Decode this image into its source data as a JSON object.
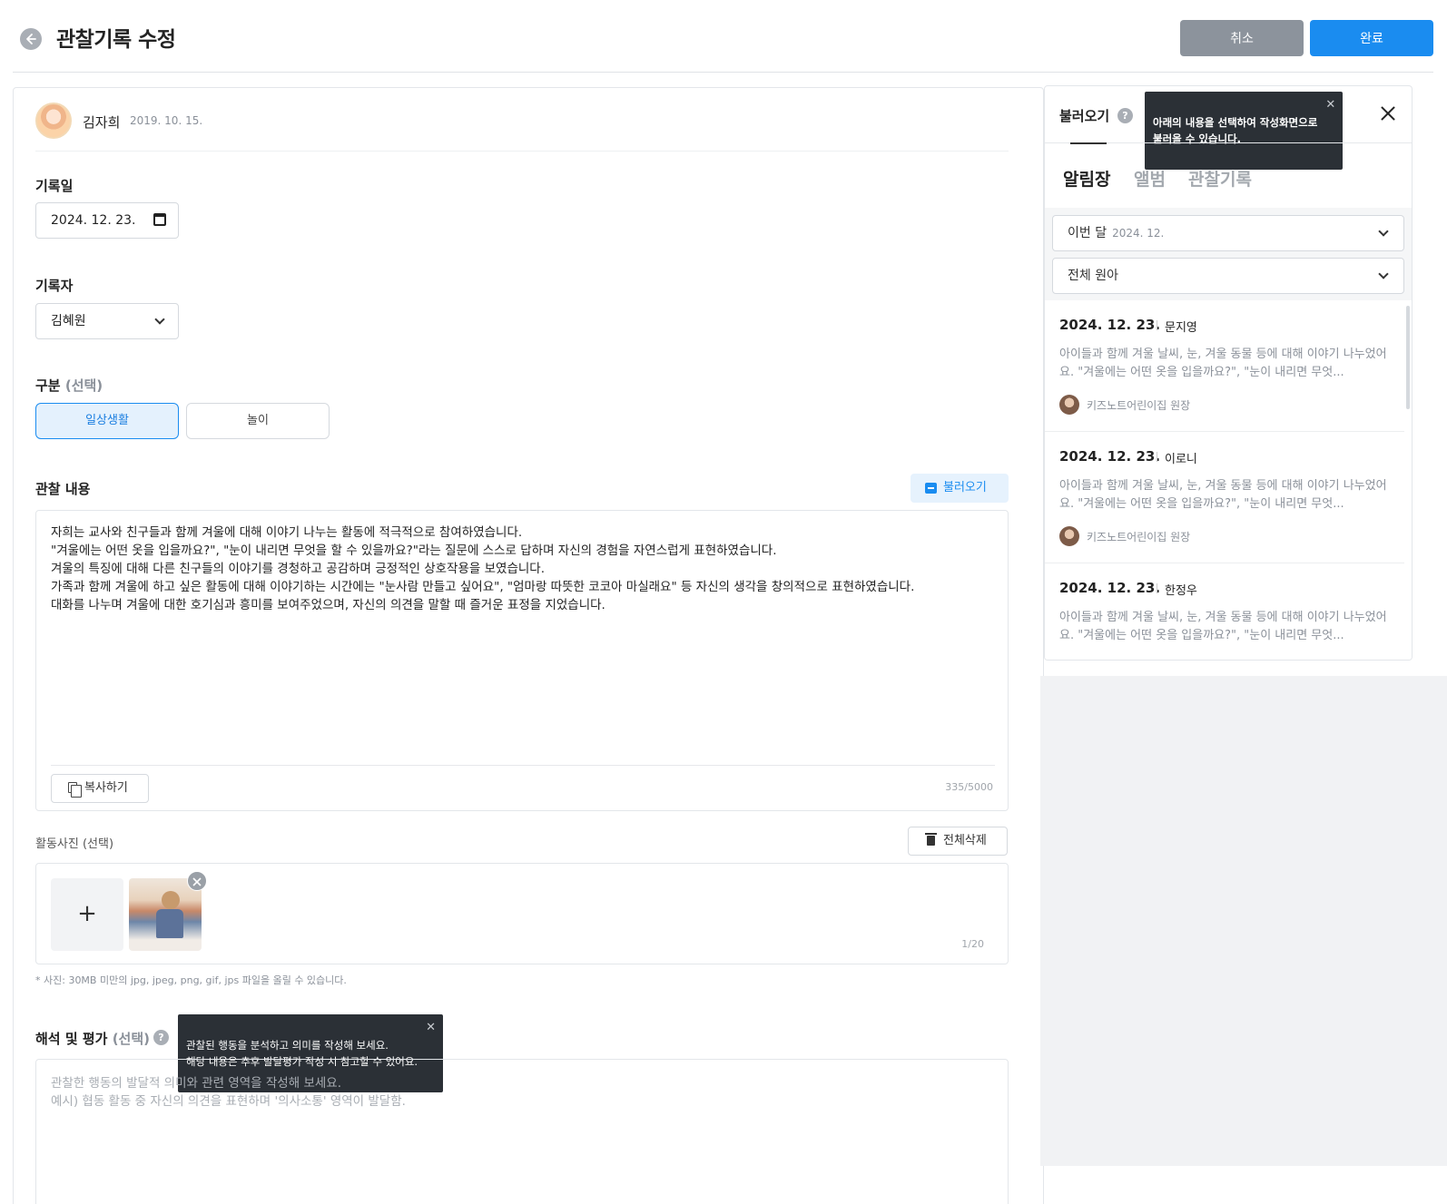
{
  "header": {
    "title": "관찰기록 수정",
    "cancel_label": "취소",
    "done_label": "완료"
  },
  "profile": {
    "name": "김자희",
    "birth": "2019. 10. 15."
  },
  "form": {
    "record_date_label": "기록일",
    "record_date_value": "2024. 12. 23.",
    "writer_label": "기록자",
    "writer_value": "김혜원",
    "category_label": "구분",
    "category_optional": "(선택)",
    "category_options": [
      "일상생활",
      "놀이"
    ],
    "category_selected": "일상생활",
    "content_label": "관찰 내용",
    "load_button": "불러오기",
    "content_text": "자희는 교사와 친구들과 함께 겨울에 대해 이야기 나누는 활동에 적극적으로 참여하였습니다.\n\"겨울에는 어떤 옷을 입을까요?\", \"눈이 내리면 무엇을 할 수 있을까요?\"라는 질문에 스스로 답하며 자신의 경험을 자연스럽게 표현하였습니다.\n겨울의 특징에 대해 다른 친구들의 이야기를 경청하고 공감하며 긍정적인 상호작용을 보였습니다.\n가족과 함께 겨울에 하고 싶은 활동에 대해 이야기하는 시간에는 \"눈사람 만들고 싶어요\", \"엄마랑 따뜻한 코코아 마실래요\" 등 자신의 생각을 창의적으로 표현하였습니다.\n대화를 나누며 겨울에 대한 호기심과 흥미를 보여주었으며, 자신의 의견을 말할 때 즐거운 표정을 지었습니다.",
    "copy_button": "복사하기",
    "char_count": "335/5000",
    "photo_label": "활동사진 (선택)",
    "delete_all_button": "전체삭제",
    "photo_add_symbol": "+",
    "photo_count": "1/20",
    "photo_note": "* 사진: 30MB 미만의 jpg, jpeg, png, gif, jps 파일을 올릴 수 있습니다.",
    "interp_label": "해석 및 평가",
    "interp_optional": "(선택)",
    "interp_tooltip": "관찰된 행동을 분석하고 의미를 작성해 보세요.\n해당 내용은 추후 발달평가 작성 시 참고할 수 있어요.",
    "interp_placeholder": "관찰한 행동의 발달적 의미와 관련 영역을 작성해 보세요.\n예시) 협동 활동 중 자신의 의견을 표현하며 '의사소통' 영역이 발달함."
  },
  "side_panel": {
    "title": "불러오기",
    "tooltip": "아래의 내용을 선택하여 작성화면으로\n불러올 수 있습니다.",
    "tabs": [
      "알림장",
      "앨범",
      "관찰기록"
    ],
    "active_tab": "알림장",
    "month_filter_label": "이번 달",
    "month_filter_value": "2024. 12.",
    "child_filter": "전체 원아",
    "cards": [
      {
        "date": "2024. 12. 23.",
        "name": "문지영",
        "body": "아이들과 함께 겨울 날씨, 눈, 겨울 동물 등에 대해 이야기 나누었어요. \"겨울에는 어떤 옷을 입을까요?\", \"눈이 내리면 무엇...",
        "author": "키즈노트어린이집 원장"
      },
      {
        "date": "2024. 12. 23.",
        "name": "이로니",
        "body": "아이들과 함께 겨울 날씨, 눈, 겨울 동물 등에 대해 이야기 나누었어요. \"겨울에는 어떤 옷을 입을까요?\", \"눈이 내리면 무엇...",
        "author": "키즈노트어린이집 원장"
      },
      {
        "date": "2024. 12. 23.",
        "name": "한정우",
        "body": "아이들과 함께 겨울 날씨, 눈, 겨울 동물 등에 대해 이야기 나누었어요. \"겨울에는 어떤 옷을 입을까요?\", \"눈이 내리면 무엇...",
        "author": ""
      }
    ]
  },
  "colors": {
    "primary": "#1a8cf0",
    "cancel": "#8c939c",
    "tooltip_bg": "#2b3036"
  }
}
